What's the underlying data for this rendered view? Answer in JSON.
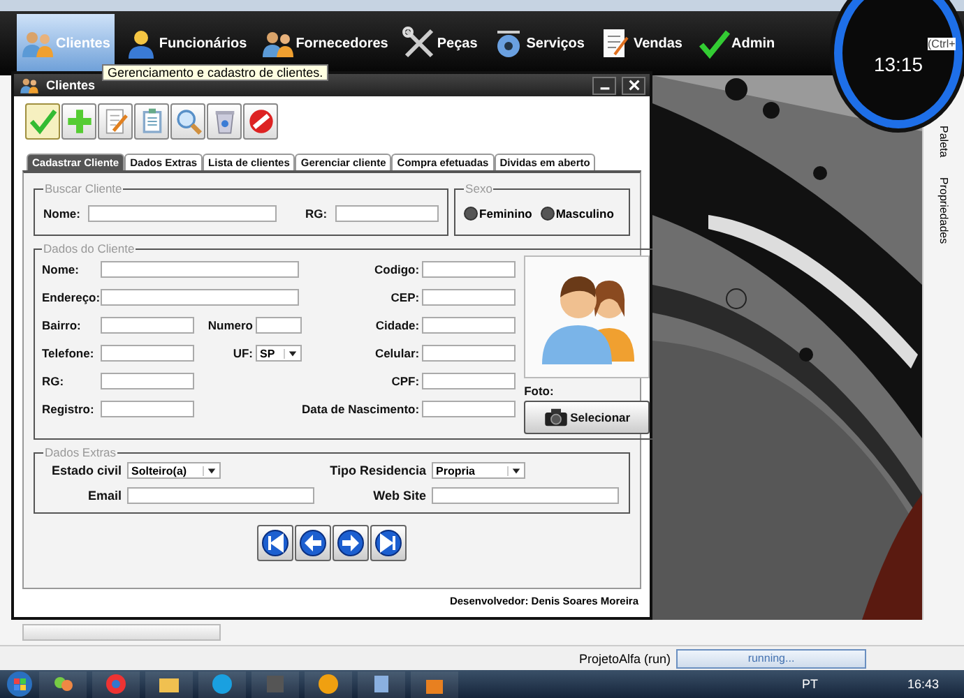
{
  "menu": [
    {
      "label": "Clientes",
      "selected": true
    },
    {
      "label": "Funcionários",
      "selected": false
    },
    {
      "label": "Fornecedores",
      "selected": false
    },
    {
      "label": "Peças",
      "selected": false
    },
    {
      "label": "Serviços",
      "selected": false
    },
    {
      "label": "Vendas",
      "selected": false
    },
    {
      "label": "Admin",
      "selected": false
    }
  ],
  "tooltip": "Gerenciamento e cadastro de clientes.",
  "clock": "13:15",
  "shortcut_hint": "(Ctrl+",
  "window": {
    "title": "Clientes"
  },
  "toolbar": [
    {
      "selected": true
    },
    {
      "selected": false
    },
    {
      "selected": false
    },
    {
      "selected": false
    },
    {
      "selected": false
    },
    {
      "selected": false
    },
    {
      "selected": false
    }
  ],
  "tabs": [
    {
      "label": "Cadastrar Cliente",
      "selected": true
    },
    {
      "label": "Dados Extras",
      "selected": false
    },
    {
      "label": "Lista de clientes",
      "selected": false
    },
    {
      "label": "Gerenciar cliente",
      "selected": false
    },
    {
      "label": "Compra efetuadas",
      "selected": false
    },
    {
      "label": "Dividas em aberto",
      "selected": false
    }
  ],
  "search_group": {
    "legend": "Buscar Cliente",
    "fields": [
      {
        "label": "Nome:"
      },
      {
        "label": "RG:"
      }
    ]
  },
  "sex_group": {
    "legend": "Sexo",
    "options": [
      {
        "label": "Feminino",
        "selected": false
      },
      {
        "label": "Masculino",
        "selected": false
      }
    ]
  },
  "client_group": {
    "legend": "Dados do Cliente",
    "rows": [
      {
        "left": [
          {
            "label": "Nome:",
            "kind": "wide"
          }
        ],
        "right": {
          "label": "Codigo:"
        }
      },
      {
        "left": [
          {
            "label": "Endereço:",
            "kind": "wide"
          }
        ],
        "right": {
          "label": "CEP:"
        }
      },
      {
        "left": [
          {
            "label": "Bairro:",
            "kind": "text"
          },
          {
            "label": "Numero",
            "kind": "short"
          }
        ],
        "right": {
          "label": "Cidade:"
        }
      },
      {
        "left": [
          {
            "label": "Telefone:",
            "kind": "text"
          },
          {
            "label": "UF:",
            "kind": "select",
            "value": "SP"
          }
        ],
        "right": {
          "label": "Celular:"
        }
      },
      {
        "left": [
          {
            "label": "RG:",
            "kind": "text"
          }
        ],
        "right": {
          "label": "CPF:"
        }
      },
      {
        "left": [
          {
            "label": "Registro:",
            "kind": "text"
          }
        ],
        "right": {
          "label": "Data de Nascimento:"
        }
      }
    ],
    "photo_label": "Foto:",
    "photo_button": "Selecionar"
  },
  "extras_group": {
    "legend": "Dados Extras",
    "fields": [
      {
        "label": "Estado civil",
        "kind": "select",
        "value": "Solteiro(a)"
      },
      {
        "label": "Tipo Residencia",
        "kind": "select",
        "value": "Propria"
      },
      {
        "label": "Email",
        "kind": "text"
      },
      {
        "label": "Web Site",
        "kind": "text"
      }
    ]
  },
  "footer": "Desenvolvedor: Denis Soares Moreira",
  "side_panel": [
    "Paleta",
    "Propriedades"
  ],
  "status_bar": {
    "project": "ProjetoAlfa (run)",
    "progress": "running...",
    "level": 1
  },
  "taskbar": {
    "language": "PT",
    "time": "16:43"
  }
}
